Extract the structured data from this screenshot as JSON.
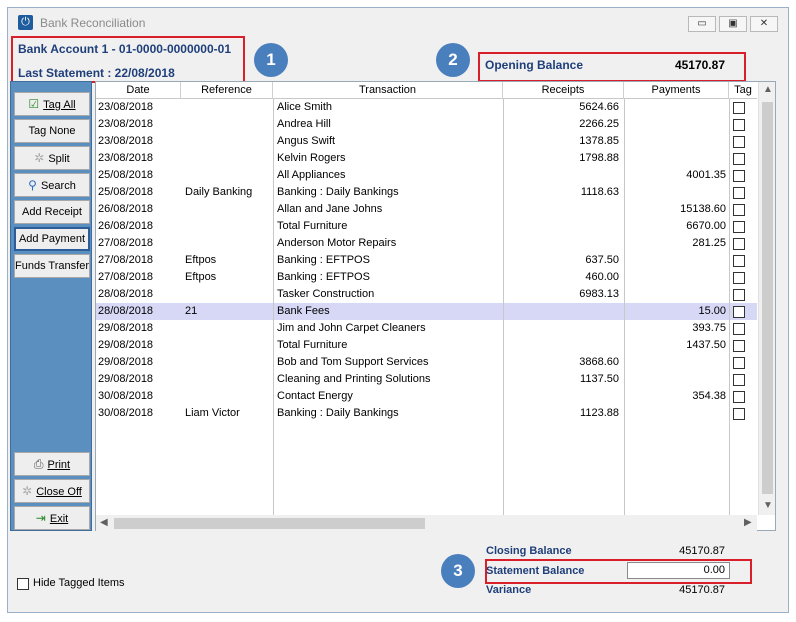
{
  "window": {
    "title": "Bank Reconciliation",
    "minimize": "▭",
    "maximize": "▣",
    "close": "✕"
  },
  "header": {
    "bank_account": "Bank Account 1 - 01-0000-0000000-01",
    "last_statement": "Last Statement : 22/08/2018",
    "opening_balance_label": "Opening Balance",
    "opening_balance_value": "45170.87"
  },
  "callouts": [
    "1",
    "2",
    "3"
  ],
  "sidebar": {
    "tag_all": "Tag All",
    "tag_none": "Tag None",
    "split": "Split",
    "search": "Search",
    "add_receipt": "Add Receipt",
    "add_payment": "Add Payment",
    "funds_transfer": "Funds Transfer",
    "print": "Print",
    "close_off": "Close Off",
    "exit": "Exit"
  },
  "table": {
    "columns": [
      "Date",
      "Reference",
      "Transaction",
      "Receipts",
      "Payments",
      "Tag"
    ],
    "rows": [
      {
        "date": "23/08/2018",
        "ref": "",
        "txn": "Alice Smith",
        "receipts": "5624.66",
        "payments": "",
        "tagged": false
      },
      {
        "date": "23/08/2018",
        "ref": "",
        "txn": "Andrea Hill",
        "receipts": "2266.25",
        "payments": "",
        "tagged": false
      },
      {
        "date": "23/08/2018",
        "ref": "",
        "txn": "Angus Swift",
        "receipts": "1378.85",
        "payments": "",
        "tagged": false
      },
      {
        "date": "23/08/2018",
        "ref": "",
        "txn": "Kelvin Rogers",
        "receipts": "1798.88",
        "payments": "",
        "tagged": false
      },
      {
        "date": "25/08/2018",
        "ref": "",
        "txn": "All Appliances",
        "receipts": "",
        "payments": "4001.35",
        "tagged": false
      },
      {
        "date": "25/08/2018",
        "ref": "Daily Banking",
        "txn": "Banking : Daily Bankings",
        "receipts": "1118.63",
        "payments": "",
        "tagged": false
      },
      {
        "date": "26/08/2018",
        "ref": "",
        "txn": "Allan and Jane Johns",
        "receipts": "",
        "payments": "15138.60",
        "tagged": false
      },
      {
        "date": "26/08/2018",
        "ref": "",
        "txn": "Total Furniture",
        "receipts": "",
        "payments": "6670.00",
        "tagged": false
      },
      {
        "date": "27/08/2018",
        "ref": "",
        "txn": "Anderson Motor Repairs",
        "receipts": "",
        "payments": "281.25",
        "tagged": false
      },
      {
        "date": "27/08/2018",
        "ref": "Eftpos",
        "txn": "Banking : EFTPOS",
        "receipts": "637.50",
        "payments": "",
        "tagged": false
      },
      {
        "date": "27/08/2018",
        "ref": "Eftpos",
        "txn": "Banking : EFTPOS",
        "receipts": "460.00",
        "payments": "",
        "tagged": false
      },
      {
        "date": "28/08/2018",
        "ref": "",
        "txn": "Tasker Construction",
        "receipts": "6983.13",
        "payments": "",
        "tagged": false
      },
      {
        "date": "28/08/2018",
        "ref": "21",
        "txn": "Bank Fees",
        "receipts": "",
        "payments": "15.00",
        "tagged": false,
        "selected": true
      },
      {
        "date": "29/08/2018",
        "ref": "",
        "txn": "Jim and John Carpet Cleaners",
        "receipts": "",
        "payments": "393.75",
        "tagged": false
      },
      {
        "date": "29/08/2018",
        "ref": "",
        "txn": "Total Furniture",
        "receipts": "",
        "payments": "1437.50",
        "tagged": false
      },
      {
        "date": "29/08/2018",
        "ref": "",
        "txn": "Bob and Tom Support Services",
        "receipts": "3868.60",
        "payments": "",
        "tagged": false
      },
      {
        "date": "29/08/2018",
        "ref": "",
        "txn": "Cleaning and Printing Solutions",
        "receipts": "1137.50",
        "payments": "",
        "tagged": false
      },
      {
        "date": "30/08/2018",
        "ref": "",
        "txn": "Contact Energy",
        "receipts": "",
        "payments": "354.38",
        "tagged": false
      },
      {
        "date": "30/08/2018",
        "ref": "Liam Victor",
        "txn": "Banking : Daily Bankings",
        "receipts": "1123.88",
        "payments": "",
        "tagged": false
      }
    ]
  },
  "summary": {
    "closing_balance_label": "Closing Balance",
    "closing_balance_value": "45170.87",
    "statement_balance_label": "Statement Balance",
    "statement_balance_value": "0.00",
    "variance_label": "Variance",
    "variance_value": "45170.87"
  },
  "footer": {
    "hide_tagged_label": "Hide Tagged Items"
  },
  "colors": {
    "sidebar_bg": "#5b8fc0",
    "header_text": "#1f3f7a",
    "callout_border": "#d9202a",
    "callout_bubble": "#4a7fbd",
    "selected_row": "#d7d8f6"
  }
}
